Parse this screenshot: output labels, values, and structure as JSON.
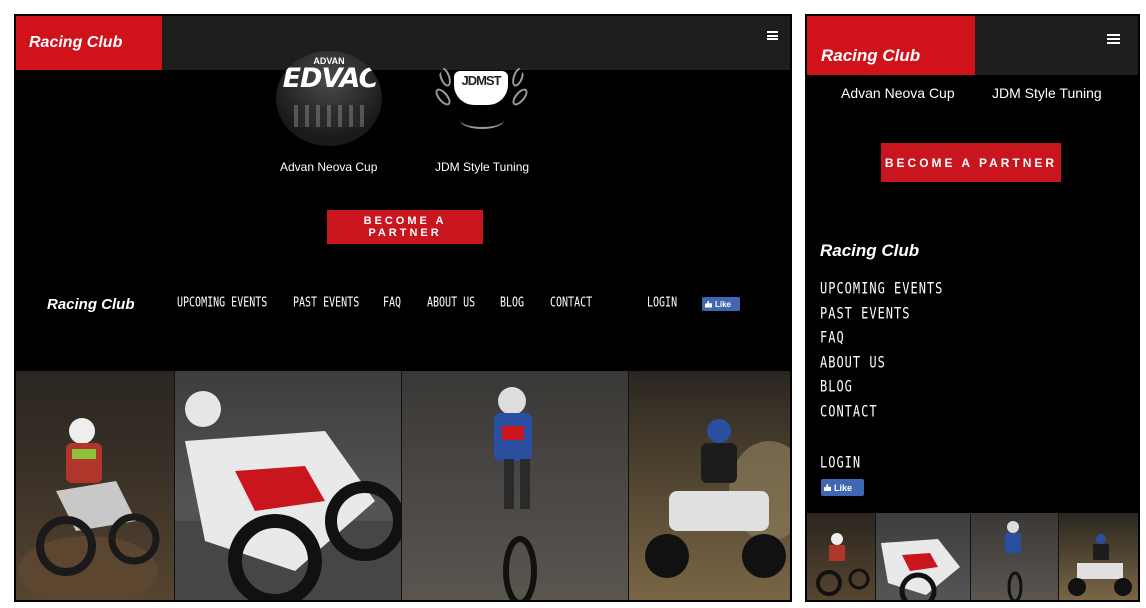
{
  "brand": "Racing Club",
  "partners": [
    {
      "logo_text": "EDVAC",
      "logo_small": "ADVAN",
      "caption": "Advan Neova Cup"
    },
    {
      "logo_text": "JDMST",
      "caption": "JDM Style Tuning"
    }
  ],
  "cta_label": "BECOME A PARTNER",
  "nav": {
    "items": [
      "UPCOMING EVENTS",
      "PAST EVENTS",
      "FAQ",
      "ABOUT US",
      "BLOG",
      "CONTACT"
    ],
    "login": "LOGIN",
    "like": "Like"
  },
  "photos": [
    {
      "subject": "motocross rider on dirt",
      "colors": [
        "#3b3125",
        "#6b8f3a",
        "#c0322b"
      ]
    },
    {
      "subject": "superbike on track",
      "colors": [
        "#5a5a5a",
        "#e6e6e6",
        "#c8151e"
      ]
    },
    {
      "subject": "motocross wheelie",
      "colors": [
        "#4e4a45",
        "#2a4ea0",
        "#c8151e"
      ]
    },
    {
      "subject": "quad bike in dust",
      "colors": [
        "#7a6a4a",
        "#1e1e1e",
        "#e8e8e8"
      ]
    }
  ],
  "colors": {
    "accent": "#d0121b",
    "topbar": "#1e1e1e",
    "background": "#000000",
    "facebook": "#4267b2"
  }
}
